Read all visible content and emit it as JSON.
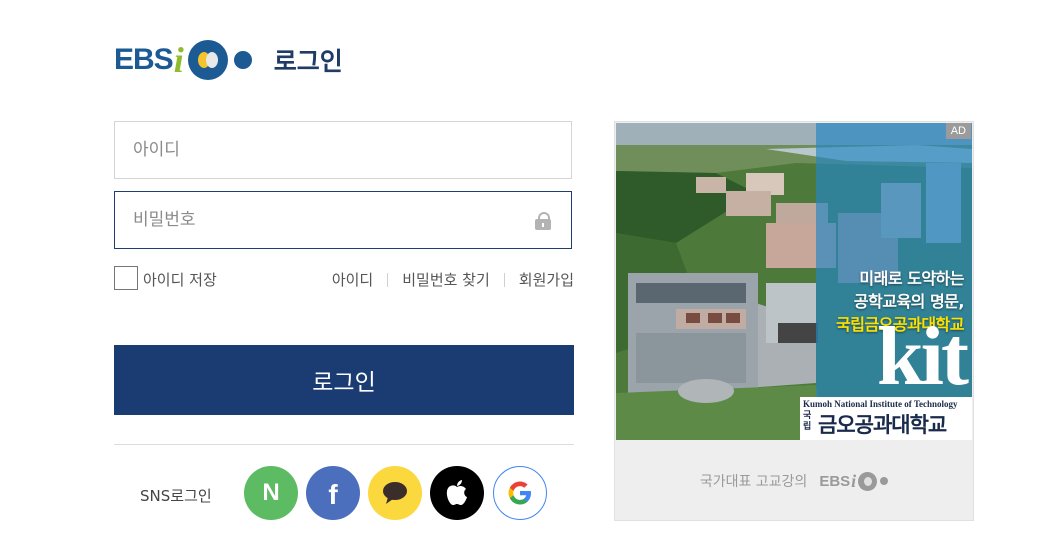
{
  "header": {
    "logo_text": "EBS",
    "logo_i": "i",
    "title": "로그인"
  },
  "form": {
    "id_placeholder": "아이디",
    "id_value": "",
    "password_placeholder": "비밀번호",
    "password_value": "",
    "remember_label": "아이디 저장",
    "remember_checked": false,
    "links": [
      "아이디",
      "비밀번호 찾기",
      "회원가입"
    ],
    "login_button": "로그인"
  },
  "sns": {
    "label": "SNS로그인",
    "providers": [
      {
        "name": "naver",
        "glyph": "N",
        "color": "#5dbb63"
      },
      {
        "name": "facebook",
        "glyph": "f",
        "color": "#4c6fbd"
      },
      {
        "name": "kakao",
        "icon": "speech-bubble-icon",
        "color": "#fcd83f"
      },
      {
        "name": "apple",
        "icon": "apple-icon",
        "color": "#000000"
      },
      {
        "name": "google",
        "glyph": "G",
        "color": "#4285f4"
      }
    ]
  },
  "ad": {
    "badge": "AD",
    "headline_1": "미래로 도약하는",
    "headline_2": "공학교육의 명문,",
    "headline_3": "국립금오공과대학교",
    "brand": "kit",
    "univ_en": "Kumoh National Institute of Technology",
    "univ_ko": "금오공과대학교",
    "univ_prefix": "국립",
    "footer_text": "국가대표 고교강의",
    "footer_logo": "EBS",
    "footer_logo_i": "i"
  },
  "colors": {
    "brand_blue": "#1b5a93",
    "navy": "#1b3c73",
    "logo_green": "#8fbc2f",
    "ad_highlight": "#ffe100"
  }
}
